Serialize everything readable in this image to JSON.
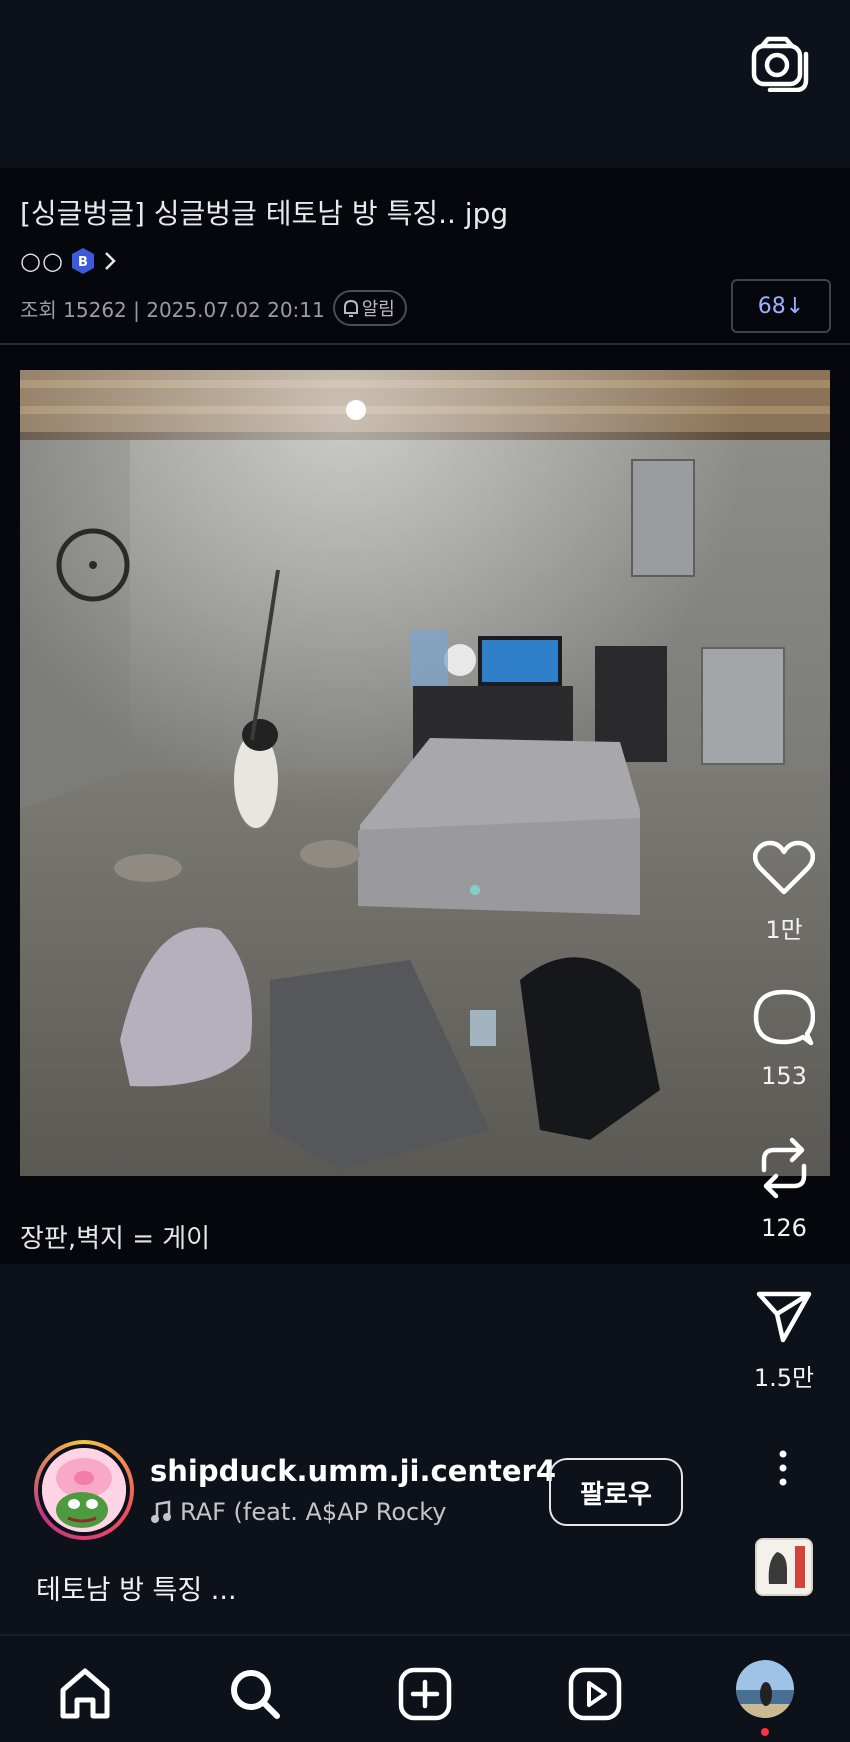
{
  "post": {
    "title": "[싱글벙글] 싱글벙글 테토남 방 특징.. jpg",
    "author_dots": "○○",
    "author_badge": "B",
    "meta": "조회 15262 | 2025.07.02 20:11",
    "alarm_label": "알림",
    "comment_count": "68↓",
    "caption": "장판,벽지 = 게이"
  },
  "actions": {
    "likes": "1만",
    "comments": "153",
    "reposts": "126",
    "shares": "1.5만"
  },
  "reel": {
    "username": "shipduck.umm.ji.center4",
    "music": "RAF (feat. A$AP Rocky",
    "follow_label": "팔로우",
    "caption": "테토남 방 특징 ..."
  },
  "colors": {
    "background": "#0d111a",
    "post_background": "#05070c",
    "comment_accent": "#9bb0ff",
    "notification_dot": "#ff3040"
  },
  "icons": [
    "camera-icon",
    "heart-icon",
    "comment-icon",
    "repost-icon",
    "send-icon",
    "more-icon",
    "home-icon",
    "search-icon",
    "add-icon",
    "reels-icon"
  ]
}
